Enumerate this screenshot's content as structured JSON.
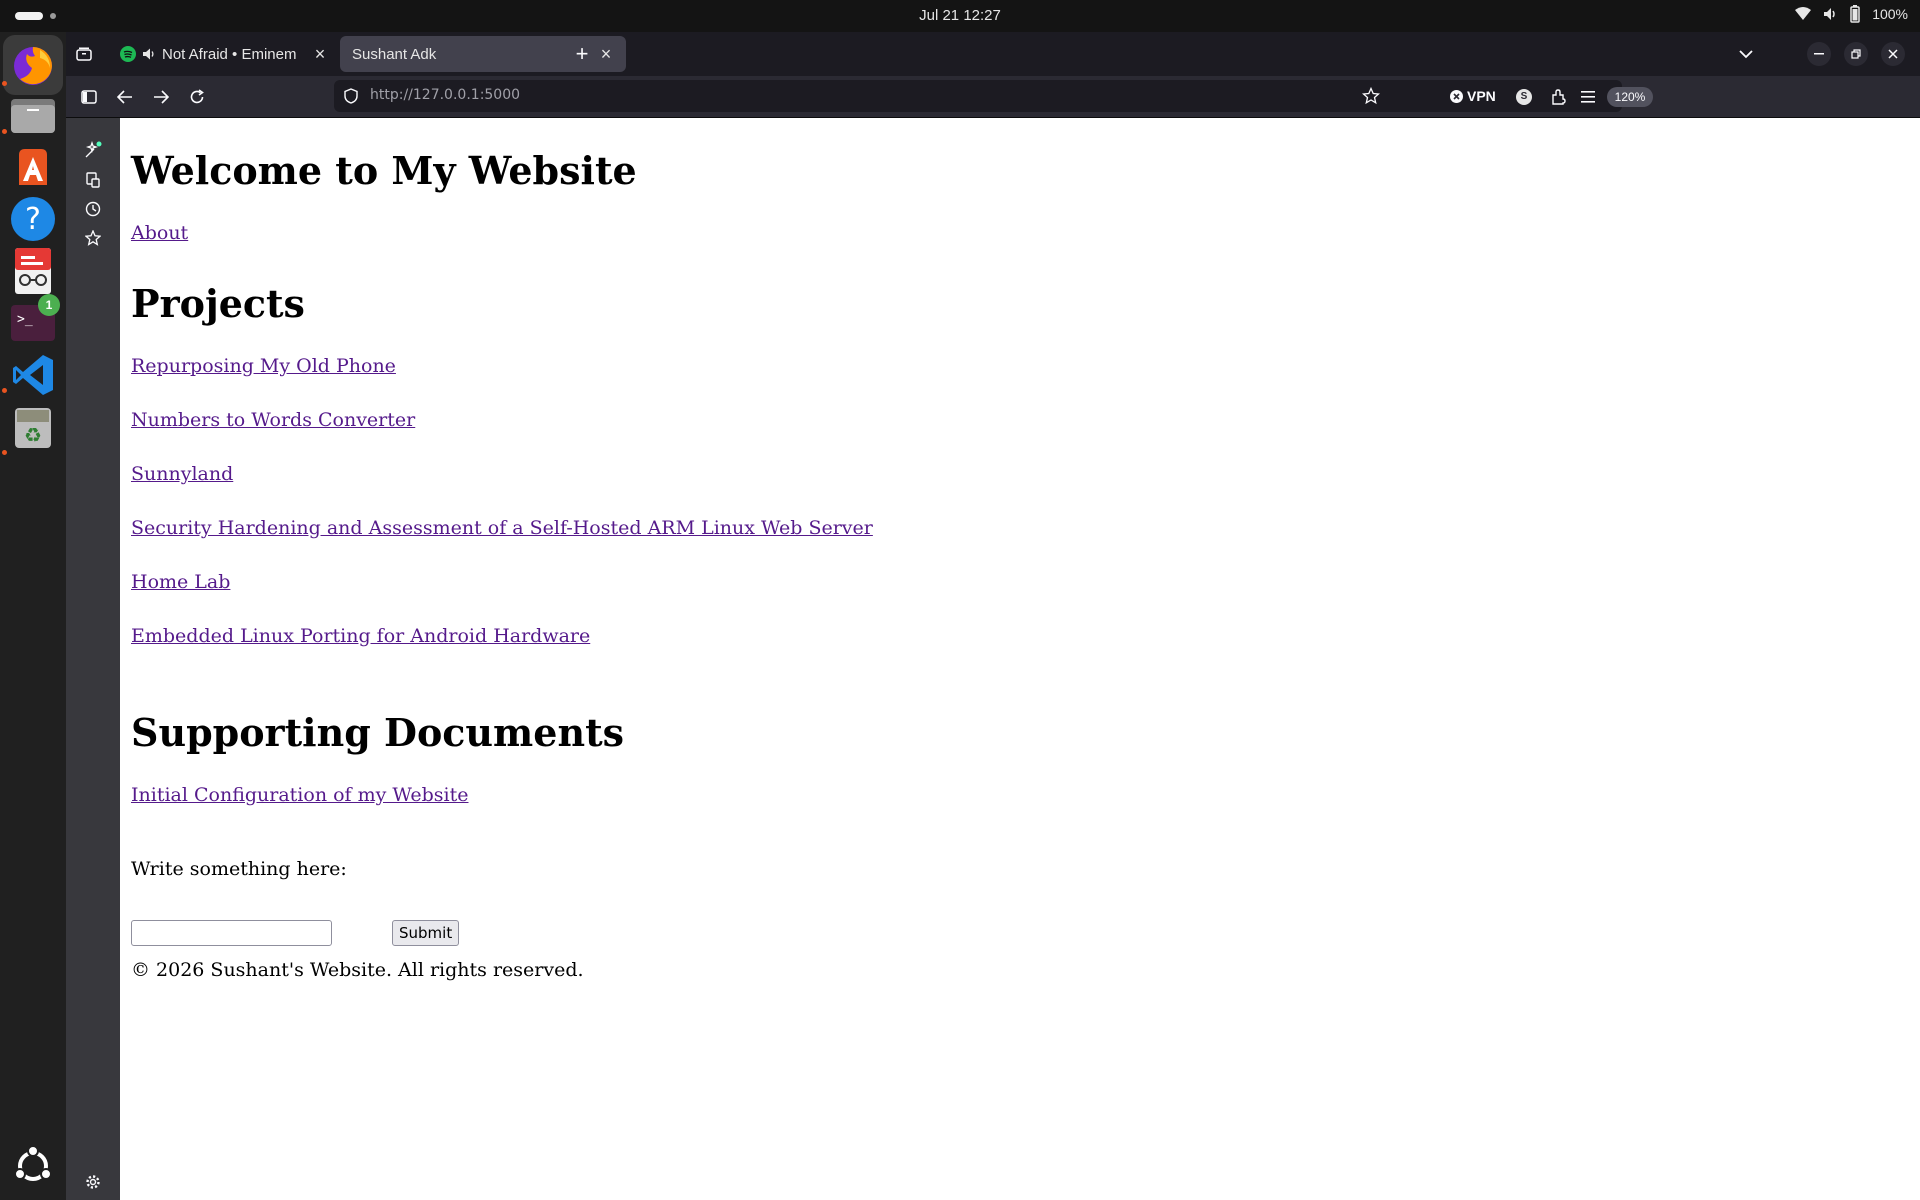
{
  "system": {
    "clock": "Jul 21  12:27",
    "battery": "100%"
  },
  "dock": {
    "apps": [
      "firefox-icon",
      "files-icon",
      "app-center-icon",
      "help-icon",
      "document-viewer-icon",
      "terminal-icon",
      "vscode-icon",
      "trash-icon",
      "ubuntu-logo"
    ],
    "terminal_badge": "1"
  },
  "browser": {
    "tabs": [
      {
        "label": "Not Afraid • Eminem",
        "icon": "spotify-icon"
      },
      {
        "label": "Sushant Adk"
      }
    ],
    "url_host": "http://127.0.0.1",
    "url_port": ":5000",
    "zoom": "120%",
    "vpn_label": "VPN",
    "profile_initial": "S"
  },
  "page": {
    "title": "Welcome to My Website",
    "about_link": "About",
    "projects_heading": "Projects",
    "projects": [
      "Repurposing My Old Phone",
      "Numbers to Words Converter",
      "Sunnyland",
      "Security Hardening and Assessment of a Self-Hosted ARM Linux Web Server",
      "Home Lab",
      "Embedded Linux Porting for Android Hardware"
    ],
    "docs_heading": "Supporting Documents",
    "docs": [
      "Initial Configuration of my Website"
    ],
    "form_label": "Write something here:",
    "input_value": "",
    "submit_label": "Submit",
    "footer": "© 2026 Sushant's Website. All rights reserved."
  },
  "colors": {
    "link": "#551a8b",
    "ubuntu_accent": "#e95420",
    "spotify": "#1db954"
  }
}
